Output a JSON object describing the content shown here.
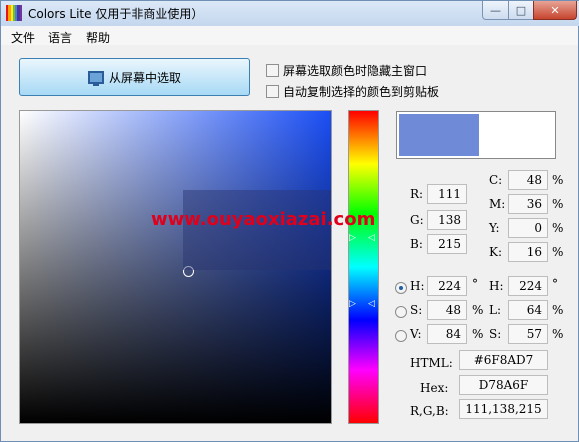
{
  "window": {
    "title": "Colors Lite 仅用于非商业使用）",
    "app_icon_colors": [
      "#e81416",
      "#ffa500",
      "#faeb36",
      "#79c314",
      "#487de7",
      "#4b369d",
      "#70369d"
    ],
    "minimize_glyph": "—",
    "maximize_glyph": "□",
    "close_glyph": "✕"
  },
  "menu": [
    "文件",
    "语言",
    "帮助"
  ],
  "pick_button": {
    "label": "从屏幕中选取",
    "icon": "monitor-icon"
  },
  "options": [
    {
      "label": "屏幕选取颜色时隐藏主窗口",
      "checked": false
    },
    {
      "label": "自动复制选择的颜色到剪贴板",
      "checked": false
    }
  ],
  "hue_markers": {
    "left": "▷",
    "right": "◁"
  },
  "watermark": "www.ouyaoxiazai.com",
  "current_color": "#6F8AD7",
  "rgb": {
    "r": {
      "label": "R:",
      "value": "111"
    },
    "g": {
      "label": "G:",
      "value": "138"
    },
    "b": {
      "label": "B:",
      "value": "215"
    }
  },
  "cmyk": {
    "c": {
      "label": "C:",
      "value": "48",
      "unit": "%"
    },
    "m": {
      "label": "M:",
      "value": "36",
      "unit": "%"
    },
    "y": {
      "label": "Y:",
      "value": "0",
      "unit": "%"
    },
    "k": {
      "label": "K:",
      "value": "16",
      "unit": "%"
    }
  },
  "hsv": {
    "h": {
      "label": "H:",
      "value": "224",
      "unit": "°",
      "selected": true
    },
    "s": {
      "label": "S:",
      "value": "48",
      "unit": "%",
      "selected": false
    },
    "v": {
      "label": "V:",
      "value": "84",
      "unit": "%",
      "selected": false
    }
  },
  "hls": {
    "h": {
      "label": "H:",
      "value": "224",
      "unit": "°"
    },
    "l": {
      "label": "L:",
      "value": "64",
      "unit": "%"
    },
    "s": {
      "label": "S:",
      "value": "57",
      "unit": "%"
    }
  },
  "codes": {
    "html": {
      "label": "HTML:",
      "value": "#6F8AD7"
    },
    "hex": {
      "label": "Hex:",
      "value": "D78A6F"
    },
    "rgb": {
      "label": "R,G,B:",
      "value": "111,138,215"
    }
  }
}
